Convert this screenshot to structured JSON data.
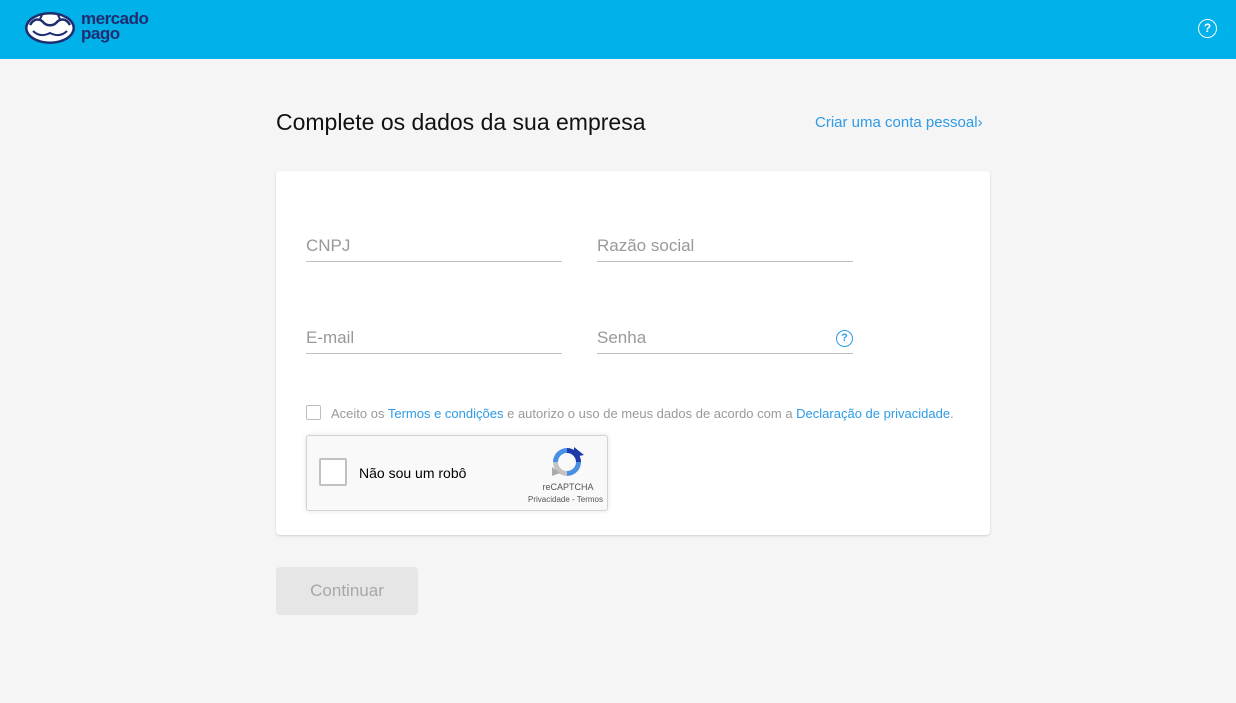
{
  "header": {
    "logo_line1": "mercado",
    "logo_line2": "pago",
    "help_icon": "question-circle-icon",
    "brand_color": "#00b1ea"
  },
  "page": {
    "title": "Complete os dados da sua empresa",
    "personal_account_link": "Criar uma conta pessoal›"
  },
  "form": {
    "cnpj": {
      "placeholder": "CNPJ",
      "value": ""
    },
    "razao_social": {
      "placeholder": "Razão social",
      "value": ""
    },
    "email": {
      "placeholder": "E-mail",
      "value": ""
    },
    "senha": {
      "placeholder": "Senha",
      "value": "",
      "help_icon": "question-circle-icon"
    },
    "terms": {
      "prefix": "Aceito os ",
      "terms_link": "Termos e condições",
      "middle": " e autorizo o uso de meus dados de acordo com a ",
      "privacy_link": "Declaração de privacidade",
      "suffix": ".",
      "checked": false
    },
    "recaptcha": {
      "label": "Não sou um robô",
      "brand": "reCAPTCHA",
      "links": "Privacidade - Termos",
      "checked": false
    }
  },
  "actions": {
    "continue_label": "Continuar",
    "continue_enabled": false
  },
  "colors": {
    "link": "#2d9be6",
    "logo_navy": "#1e2e70"
  }
}
